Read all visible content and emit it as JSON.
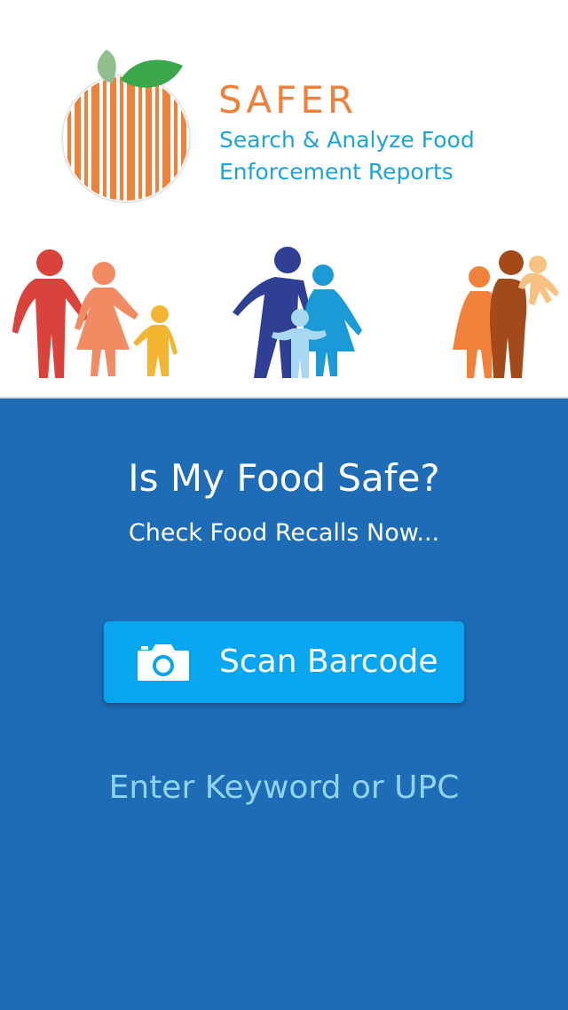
{
  "brand": {
    "title": "SAFER",
    "subtitle_line1": "Search & Analyze Food",
    "subtitle_line2": "Enforcement Reports"
  },
  "hero": {
    "headline": "Is My Food Safe?",
    "subline": "Check Food Recalls Now..."
  },
  "actions": {
    "scan_label": "Scan Barcode",
    "keyword_label": "Enter Keyword or UPC"
  },
  "colors": {
    "brand_orange": "#f0813a",
    "brand_blue": "#1da3d8",
    "panel_blue": "#1e6bb6",
    "button_blue": "#08a6ee",
    "link_blue": "#8fd3f7"
  },
  "icons": [
    "orange-barcode-logo-icon",
    "camera-icon",
    "family-illustration"
  ]
}
